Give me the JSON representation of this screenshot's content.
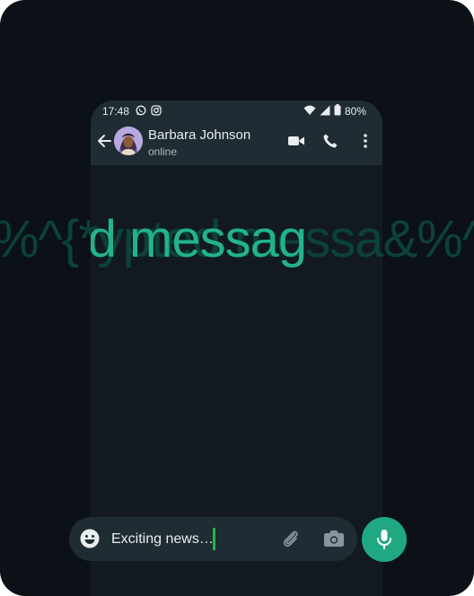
{
  "status_bar": {
    "time": "17:48",
    "battery": "80%",
    "notification_icons": [
      "whatsapp-icon",
      "instagram-icon"
    ],
    "system_icons": [
      "wifi-icon",
      "signal-icon",
      "battery-icon"
    ]
  },
  "chat_header": {
    "contact_name": "Barbara Johnson",
    "presence": "online",
    "actions": [
      "video-call-icon",
      "voice-call-icon",
      "more-options-icon"
    ]
  },
  "background_text": {
    "scrambled": "%^{*ypted messa&%^",
    "clear": "ypted messag"
  },
  "composer": {
    "draft_text": "Exciting news…",
    "icons": [
      "emoji-icon",
      "attach-icon",
      "camera-icon",
      "mic-icon"
    ]
  },
  "colors": {
    "background": "#0b1117",
    "chat_surface": "#121a20",
    "header": "#1f2c33",
    "accent": "#20a882",
    "cursor": "#22b34f",
    "encrypted_text_bright": "#22b38a",
    "encrypted_text_dim": "#0c4238"
  }
}
